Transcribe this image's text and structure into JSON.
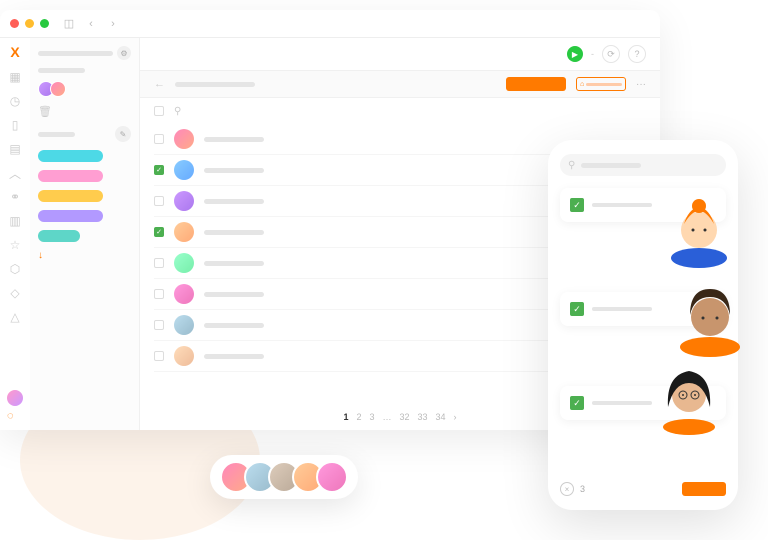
{
  "window": {
    "controls": [
      "close",
      "minimize",
      "zoom"
    ],
    "nav": [
      "sidebar-toggle",
      "back",
      "forward"
    ]
  },
  "rail": {
    "logo": "X",
    "icons": [
      "grid",
      "clock",
      "clipboard",
      "doc",
      "chevron-up",
      "users",
      "report",
      "star",
      "pin",
      "tag",
      "shape"
    ]
  },
  "navcol": {
    "tags": [
      {
        "color": "cyan"
      },
      {
        "color": "pink"
      },
      {
        "color": "yel"
      },
      {
        "color": "pur"
      },
      {
        "color": "teal"
      }
    ]
  },
  "topbar": {
    "play": "▶",
    "icons": [
      "dash",
      "refresh",
      "help"
    ]
  },
  "subhead": {
    "primary_label": "",
    "outline_label": "",
    "more": "···"
  },
  "list": {
    "rows": [
      {
        "checked": false,
        "av": "g1"
      },
      {
        "checked": true,
        "av": "g2"
      },
      {
        "checked": false,
        "av": "g3"
      },
      {
        "checked": true,
        "av": "g4"
      },
      {
        "checked": false,
        "av": "g5"
      },
      {
        "checked": false,
        "av": "g6"
      },
      {
        "checked": false,
        "av": "g7"
      },
      {
        "checked": false,
        "av": "g8"
      }
    ]
  },
  "pager": {
    "pages": [
      "1",
      "2",
      "3",
      "…",
      "32",
      "33",
      "34"
    ],
    "active": "1",
    "next": "›"
  },
  "phone": {
    "cards": [
      {
        "checked": true
      },
      {
        "checked": true
      },
      {
        "checked": true
      }
    ],
    "footer_count": "3"
  },
  "avbar": {
    "count": 5
  }
}
